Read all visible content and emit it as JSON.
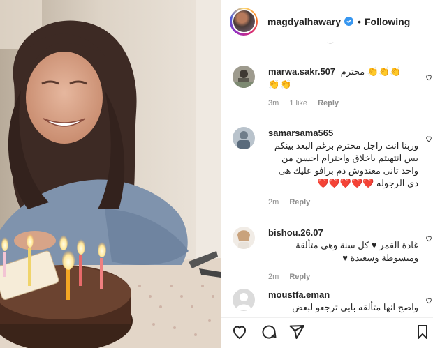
{
  "post": {
    "username": "magdyalhawary",
    "follow_status": "Following",
    "separator": "•"
  },
  "comments": [
    {
      "username": "marwa.sakr.507",
      "text": "محترم 👏👏👏",
      "text2": "👏👏",
      "time": "3m",
      "likes": "1 like",
      "reply": "Reply"
    },
    {
      "username": "samarsama565",
      "text": "وربنا انت راجل محترم برغم البعد بينكم بس انتهيتم باخلاق واحترام احسن من واحد تانى معندوش دم برافو عليك هى دى الرجوله ❤️❤️❤️❤️❤️",
      "time": "2m",
      "reply": "Reply"
    },
    {
      "username": "bishou.26.07",
      "text": "غادة القمر ♥ كل سنة وهي متألقة ومبسوطة وسعيدة ♥",
      "time": "2m",
      "reply": "Reply"
    },
    {
      "username": "moustfa.eman",
      "text": "واضح انها متألقه بابي ترجعو لبعض"
    }
  ],
  "icons": {
    "verified": "verified-badge-icon",
    "heart": "heart-icon",
    "comment": "comment-icon",
    "share": "share-icon",
    "bookmark": "bookmark-icon"
  },
  "colors": {
    "verified_blue": "#3897f0",
    "meta_gray": "#8e8e8e",
    "text": "#262626"
  }
}
